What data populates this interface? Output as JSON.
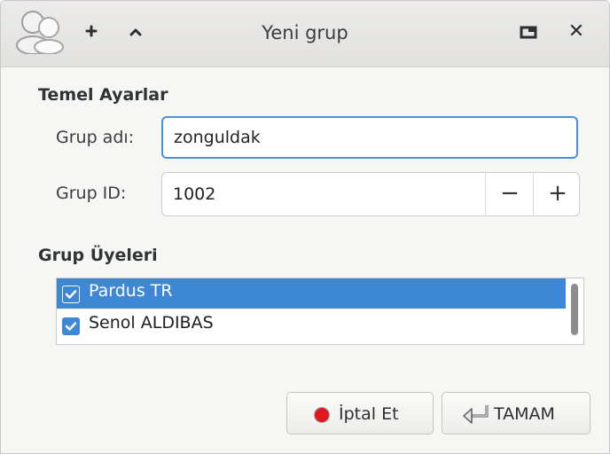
{
  "window": {
    "title": "Yeni grup",
    "titlebar_buttons": {
      "add_icon": "plus-icon",
      "up_icon": "chevron-up-icon",
      "maximize_icon": "maximize-icon",
      "close_glyph": "✕"
    }
  },
  "basic": {
    "section_title": "Temel Ayarlar",
    "group_name_label": "Grup adı:",
    "group_name_value": "zonguldak",
    "group_id_label": "Grup ID:",
    "group_id_value": "1002",
    "minus": "−",
    "plus": "+"
  },
  "members": {
    "section_title": "Grup Üyeleri",
    "items": [
      {
        "label": "Pardus TR",
        "checked": true,
        "selected": true
      },
      {
        "label": "Senol ALDIBAS",
        "checked": true,
        "selected": false
      }
    ]
  },
  "buttons": {
    "cancel_label": "İptal Et",
    "ok_label": "TAMAM"
  },
  "colors": {
    "accent": "#3d87d4",
    "stop_red": "#e0191f"
  }
}
